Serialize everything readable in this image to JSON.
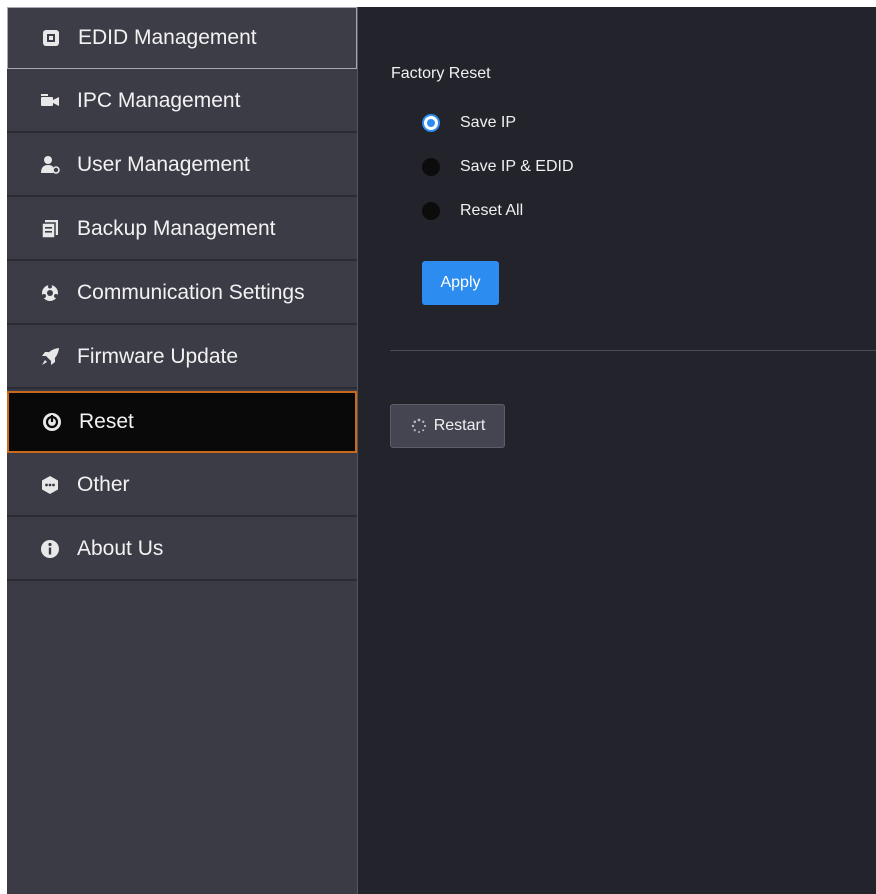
{
  "sidebar": {
    "items": [
      {
        "label": "EDID Management",
        "icon": "edid-icon"
      },
      {
        "label": "IPC Management",
        "icon": "camera-icon"
      },
      {
        "label": "User Management",
        "icon": "user-icon"
      },
      {
        "label": "Backup Management",
        "icon": "backup-icon"
      },
      {
        "label": "Communication Settings",
        "icon": "communication-icon"
      },
      {
        "label": "Firmware Update",
        "icon": "rocket-icon"
      },
      {
        "label": "Reset",
        "icon": "power-icon",
        "active": true
      },
      {
        "label": "Other",
        "icon": "chat-icon"
      },
      {
        "label": "About Us",
        "icon": "info-icon"
      }
    ]
  },
  "factory_reset": {
    "title": "Factory Reset",
    "options": [
      {
        "label": "Save IP",
        "checked": true
      },
      {
        "label": "Save IP & EDID",
        "checked": false
      },
      {
        "label": "Reset All",
        "checked": false
      }
    ],
    "apply_label": "Apply"
  },
  "restart": {
    "label": "Restart",
    "icon": "spinner-icon"
  },
  "colors": {
    "accent": "#2d8cf0",
    "active_border": "#c9691c",
    "background": "#23232c",
    "sidebar": "#3b3b46"
  }
}
